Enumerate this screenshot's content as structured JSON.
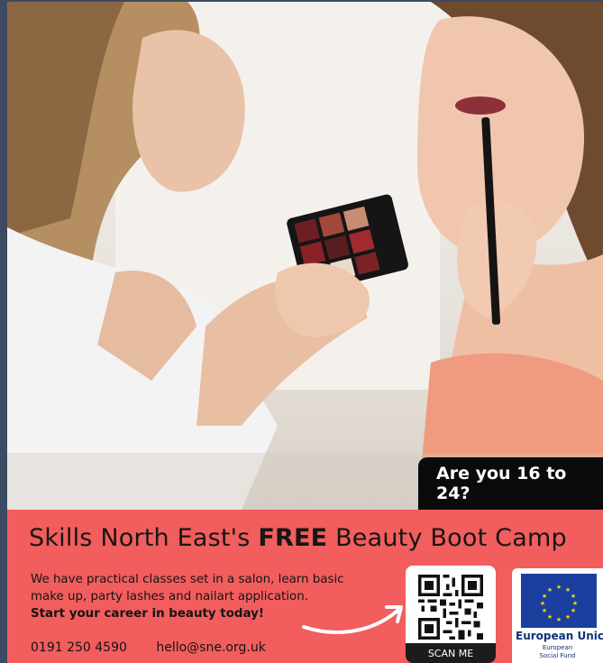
{
  "badge": {
    "text": "Are you 16 to 24?"
  },
  "banner": {
    "headline_pre": "Skills North East's ",
    "headline_bold": "FREE",
    "headline_post": " Beauty Boot Camp",
    "body_line1": "We have practical classes set in a salon, learn basic",
    "body_line2": "make up, party lashes and nailart application.",
    "body_strong": "Start your career in beauty today!",
    "phone": "0191 250 4590",
    "email": "hello@sne.org.uk",
    "scan_label": "SCAN ME"
  },
  "eu": {
    "title": "European Unic",
    "line1": "European",
    "line2": "Social Fund"
  },
  "colors": {
    "banner": "#f25d5d",
    "badge": "#0b0b0c",
    "eu_blue": "#1a3f9f",
    "eu_star": "#ffd400",
    "frame": "#3c4a62"
  },
  "icons": [
    "qr-code-icon",
    "curved-arrow-icon",
    "eu-flag-icon"
  ]
}
